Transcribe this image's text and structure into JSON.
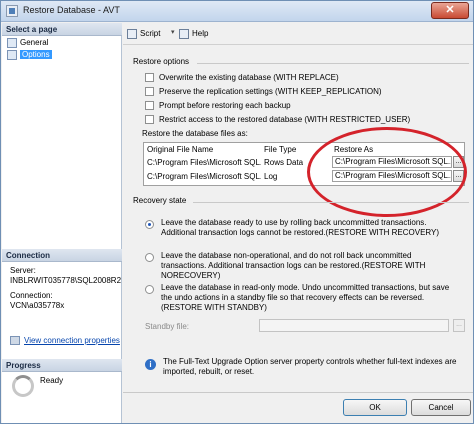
{
  "window": {
    "title": "Restore Database - AVT",
    "close_symbol": "✕"
  },
  "left_pane": {
    "select_page_header": "Select a page",
    "pages": [
      {
        "label": "General",
        "selected": false
      },
      {
        "label": "Options",
        "selected": true
      }
    ],
    "connection_header": "Connection",
    "server_label": "Server:",
    "server_value": "INBLRWIT035778\\SQL2008R2",
    "connection_label": "Connection:",
    "connection_value": "VCN\\a035778x",
    "view_connection_link": "View connection properties",
    "progress_header": "Progress",
    "progress_status": "Ready"
  },
  "toolbar": {
    "script_label": "Script",
    "script_arrow": "▾",
    "help_label": "Help"
  },
  "restore_options": {
    "section_label": "Restore options",
    "checkboxes": [
      {
        "label": "Overwrite the existing database (WITH REPLACE)",
        "checked": false
      },
      {
        "label": "Preserve the replication settings (WITH KEEP_REPLICATION)",
        "checked": false
      },
      {
        "label": "Prompt before restoring each backup",
        "checked": false
      },
      {
        "label": "Restrict access to the restored database (WITH RESTRICTED_USER)",
        "checked": false
      }
    ]
  },
  "files": {
    "label": "Restore the database files as:",
    "columns": [
      "Original File Name",
      "File Type",
      "Restore As"
    ],
    "rows": [
      {
        "original": "C:\\Program Files\\Microsoft SQL...",
        "type": "Rows Data",
        "restore_as": "C:\\Program Files\\Microsoft SQL...",
        "browse": "..."
      },
      {
        "original": "C:\\Program Files\\Microsoft SQL...",
        "type": "Log",
        "restore_as": "C:\\Program Files\\Microsoft SQL...",
        "browse": "..."
      }
    ]
  },
  "recovery": {
    "section_label": "Recovery state",
    "options": [
      {
        "text": "Leave the database ready to use by rolling back uncommitted transactions. Additional transaction logs cannot be restored.(RESTORE WITH RECOVERY)",
        "checked": true
      },
      {
        "text": "Leave the database non-operational, and do not roll back uncommitted transactions. Additional transaction logs can be restored.(RESTORE WITH NORECOVERY)",
        "checked": false
      },
      {
        "text": "Leave the database in read-only mode. Undo uncommitted transactions, but save the undo actions in a standby file so that recovery effects can be reversed.(RESTORE WITH STANDBY)",
        "checked": false
      }
    ],
    "standby_label": "Standby file:",
    "standby_browse": "..."
  },
  "info": {
    "icon": "i",
    "text": "The Full-Text Upgrade Option server property controls whether full-text indexes are imported, rebuilt, or reset."
  },
  "buttons": {
    "ok": "OK",
    "cancel": "Cancel"
  },
  "colors": {
    "annotation_ellipse": "#d4232b",
    "selection": "#3399ff"
  }
}
